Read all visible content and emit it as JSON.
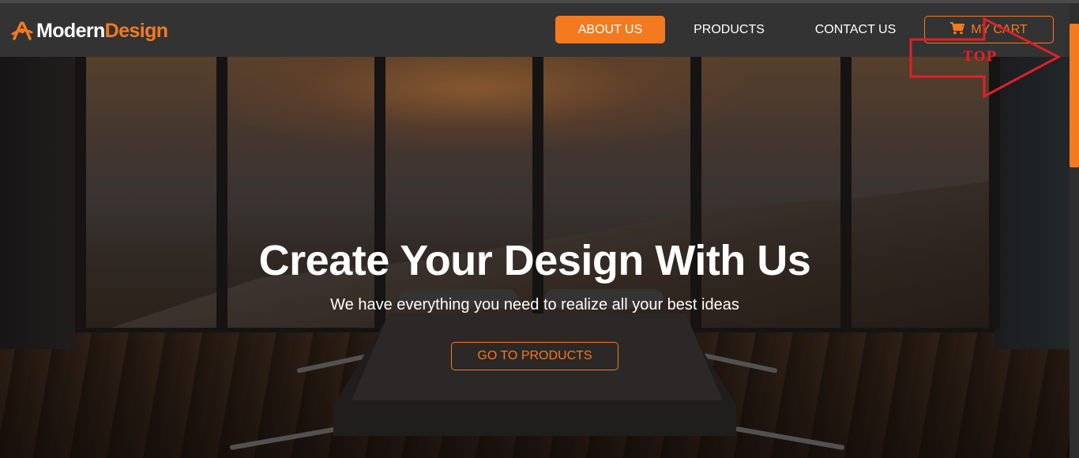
{
  "brand": {
    "name_part1": "Modern",
    "name_part2": "Design",
    "accent_color": "#f47a1f",
    "logo_icon": "logo-mark-icon"
  },
  "nav": {
    "items": [
      {
        "label": "ABOUT US",
        "active": true
      },
      {
        "label": "PRODUCTS",
        "active": false
      },
      {
        "label": "CONTACT US",
        "active": false
      }
    ],
    "cart": {
      "label": "MY CART",
      "icon": "cart-icon"
    }
  },
  "hero": {
    "title": "Create Your Design With Us",
    "subtitle": "We have everything you need to realize all your best ideas",
    "cta_label": "GO TO PRODUCTS"
  },
  "annotation": {
    "label": "TOP",
    "color": "#e0202a",
    "icon": "right-arrow-icon"
  },
  "scrollbar": {
    "thumb_color": "#f47a1f",
    "position": 0
  }
}
